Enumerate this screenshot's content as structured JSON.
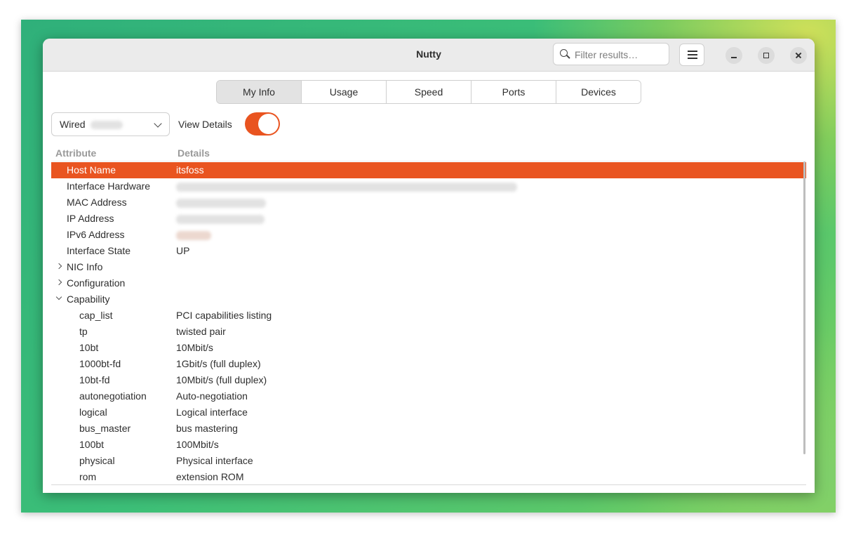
{
  "window": {
    "title": "Nutty"
  },
  "search": {
    "placeholder": "Filter results…"
  },
  "tabs": [
    {
      "label": "My Info",
      "active": true
    },
    {
      "label": "Usage",
      "active": false
    },
    {
      "label": "Speed",
      "active": false
    },
    {
      "label": "Ports",
      "active": false
    },
    {
      "label": "Devices",
      "active": false
    }
  ],
  "interface_select": {
    "label": "Wired"
  },
  "view_details": {
    "label": "View Details",
    "enabled": true
  },
  "table": {
    "headers": {
      "attribute": "Attribute",
      "details": "Details"
    },
    "rows": [
      {
        "attribute": "Host Name",
        "details": "itsfoss"
      },
      {
        "attribute": "Interface Hardware",
        "details": ""
      },
      {
        "attribute": "MAC Address",
        "details": ""
      },
      {
        "attribute": "IP Address",
        "details": ""
      },
      {
        "attribute": "IPv6 Address",
        "details": ""
      },
      {
        "attribute": "Interface State",
        "details": "UP"
      },
      {
        "attribute": "NIC Info",
        "details": ""
      },
      {
        "attribute": "Configuration",
        "details": ""
      },
      {
        "attribute": "Capability",
        "details": ""
      },
      {
        "attribute": "cap_list",
        "details": "PCI capabilities listing"
      },
      {
        "attribute": "tp",
        "details": "twisted pair"
      },
      {
        "attribute": "10bt",
        "details": "10Mbit/s"
      },
      {
        "attribute": "1000bt-fd",
        "details": "1Gbit/s (full duplex)"
      },
      {
        "attribute": "10bt-fd",
        "details": "10Mbit/s (full duplex)"
      },
      {
        "attribute": "autonegotiation",
        "details": "Auto-negotiation"
      },
      {
        "attribute": "logical",
        "details": "Logical interface"
      },
      {
        "attribute": "bus_master",
        "details": "bus mastering"
      },
      {
        "attribute": "100bt",
        "details": "100Mbit/s"
      },
      {
        "attribute": "physical",
        "details": "Physical interface"
      },
      {
        "attribute": "rom",
        "details": "extension ROM"
      }
    ]
  },
  "colors": {
    "accent": "#e95420",
    "tab_active": "#e3e3e3",
    "titlebar": "#ebebeb"
  },
  "icons": {
    "search": "search-icon",
    "menu": "hamburger-menu-icon",
    "minimize": "minimize-icon",
    "maximize": "maximize-icon",
    "close": "close-icon",
    "dropdown": "chevron-down-icon",
    "expand": "chevron-right-icon",
    "collapse": "chevron-down-icon"
  }
}
